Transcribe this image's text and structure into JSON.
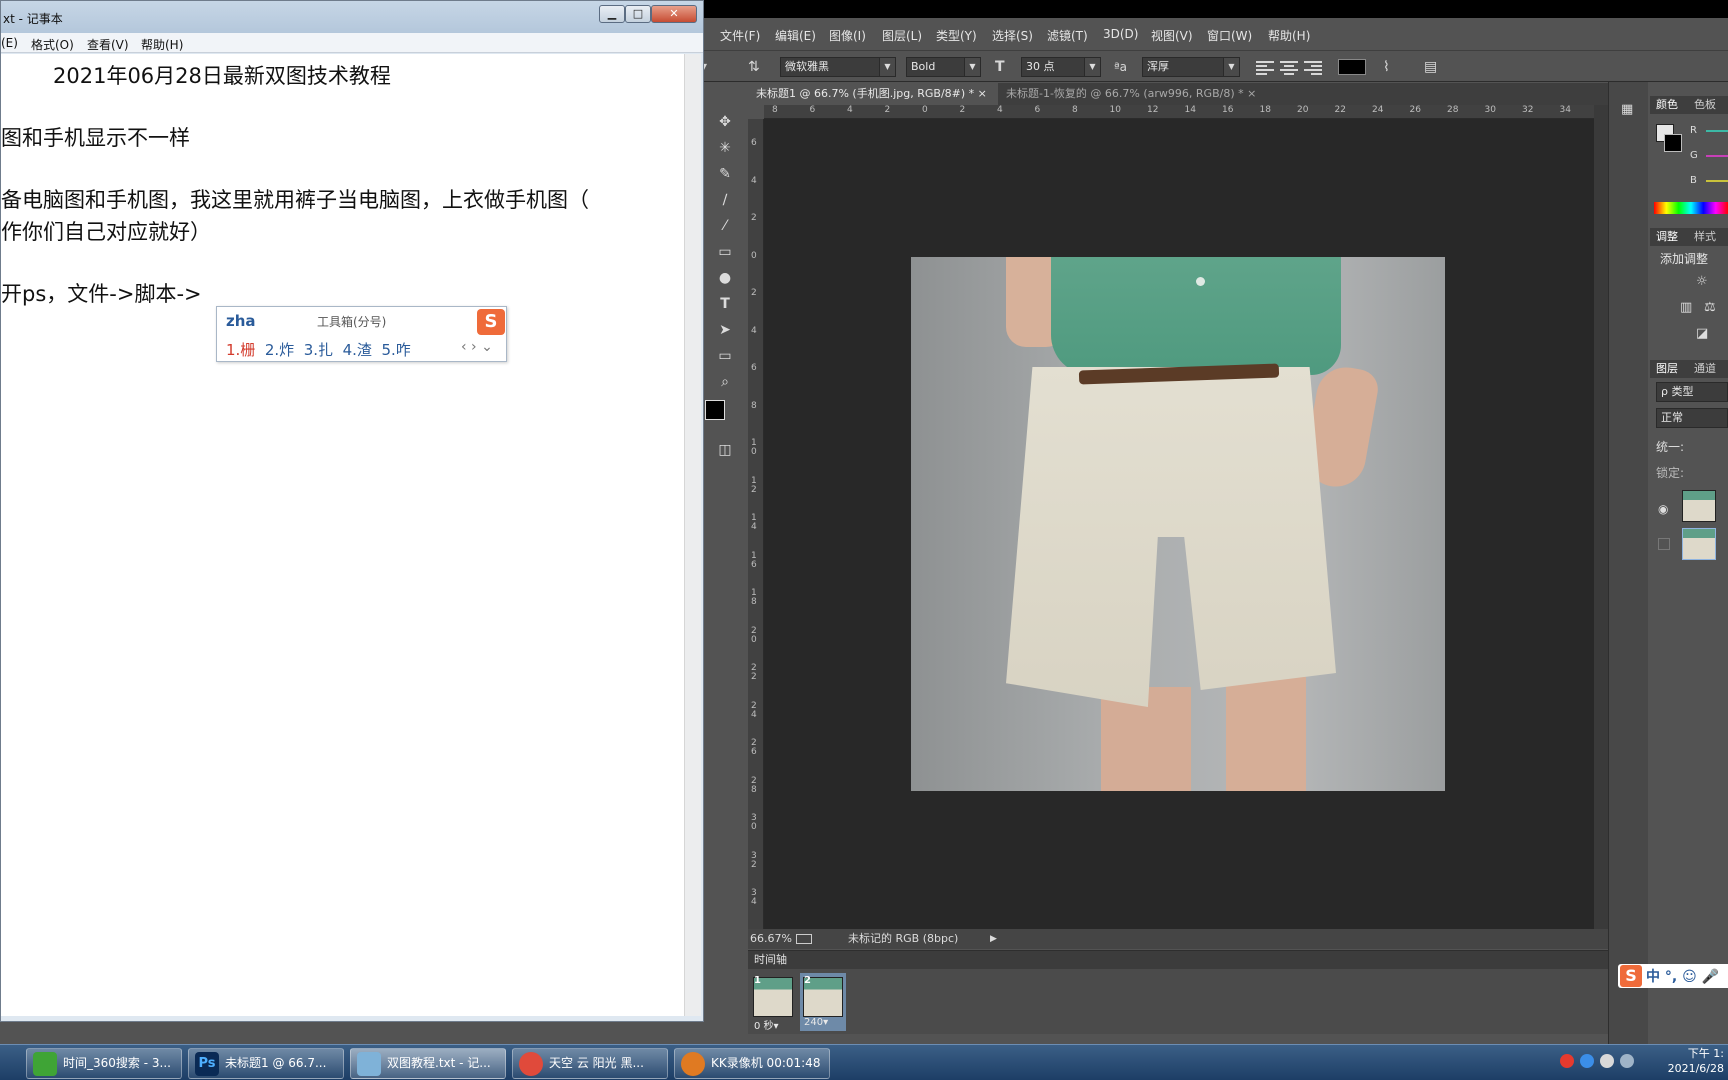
{
  "notepad": {
    "title": "xt - 记事本",
    "menu": [
      "(E)",
      "格式(O)",
      "查看(V)",
      "帮助(H)"
    ],
    "lines": [
      "2021年06月28日最新双图技术教程",
      "图和手机显示不一样",
      "备电脑图和手机图，我这里就用裤子当电脑图，上衣做手机图（",
      "作你们自己对应就好）",
      "开ps，文件->脚本->"
    ],
    "controls": {
      "minimize": "▁",
      "maximize": "□",
      "close": "✕"
    }
  },
  "ime": {
    "pinyin": "zha",
    "hint": "工具箱(分号)",
    "logo": "S",
    "candidates": [
      "1.栅",
      "2.炸",
      "3.扎",
      "4.渣",
      "5.咋"
    ],
    "nav": "‹ › ⌄"
  },
  "photoshop": {
    "menu": [
      "文件(F)",
      "编辑(E)",
      "图像(I)",
      "图层(L)",
      "类型(Y)",
      "选择(S)",
      "滤镜(T)",
      "3D(D)",
      "视图(V)",
      "窗口(W)",
      "帮助(H)"
    ],
    "options": {
      "font_family": "微软雅黑",
      "font_style": "Bold",
      "font_size": "30 点",
      "antialias_label": "ªa",
      "antialias": "浑厚",
      "text_color": "#000000"
    },
    "tabs": [
      {
        "label": "未标题1 @ 66.7% (手机图.jpg, RGB/8#) *",
        "close": "×"
      },
      {
        "label": "未标题-1-恢复的 @ 66.7% (arw996, RGB/8) *",
        "close": "×"
      }
    ],
    "ruler_h": [
      "8",
      "6",
      "4",
      "2",
      "0",
      "2",
      "4",
      "6",
      "8",
      "10",
      "12",
      "14",
      "16",
      "18",
      "20",
      "22",
      "24",
      "26",
      "28",
      "30",
      "32",
      "34"
    ],
    "ruler_v": [
      "6",
      "4",
      "2",
      "0",
      "2",
      "4",
      "6",
      "8",
      "1 0",
      "1 2",
      "1 4",
      "1 6",
      "1 8",
      "2 0",
      "2 2",
      "2 4",
      "2 6",
      "2 8",
      "3 0",
      "3 2",
      "3 4"
    ],
    "status": {
      "zoom": "66.67%",
      "doc_info": "未标记的 RGB (8bpc)"
    },
    "timeline": {
      "title": "时间轴",
      "frames": [
        {
          "num": "1",
          "duration": "0 秒▾"
        },
        {
          "num": "2",
          "duration": "240▾"
        }
      ]
    },
    "right_panels": {
      "color_tabs": [
        "颜色",
        "色板"
      ],
      "rgb_labels": [
        "R",
        "G",
        "B"
      ],
      "adjust_tabs": [
        "调整",
        "样式"
      ],
      "adjust_title": "添加调整",
      "layers_tabs": [
        "图层",
        "通道"
      ],
      "kind": "ρ 类型",
      "blend": "正常",
      "unify": "统一:",
      "lock": "锁定:"
    }
  },
  "taskbar": {
    "tasks": [
      {
        "label": "时间_360搜索 - 3...",
        "color": "#3fa436"
      },
      {
        "label": "未标题1 @ 66.7...",
        "color": "#0a2a55"
      },
      {
        "label": "双图教程.txt - 记...",
        "color": "#7fb2d8"
      },
      {
        "label": "天空 云 阳光 黑...",
        "color": "#e04a3b"
      },
      {
        "label": "KK录像机 00:01:48",
        "color": "#e07a22"
      }
    ],
    "clock_time": "下午 1:",
    "clock_date": "2021/6/28"
  },
  "ime_bar": {
    "logo": "S",
    "text": "中 °, ☺ 🎤"
  }
}
